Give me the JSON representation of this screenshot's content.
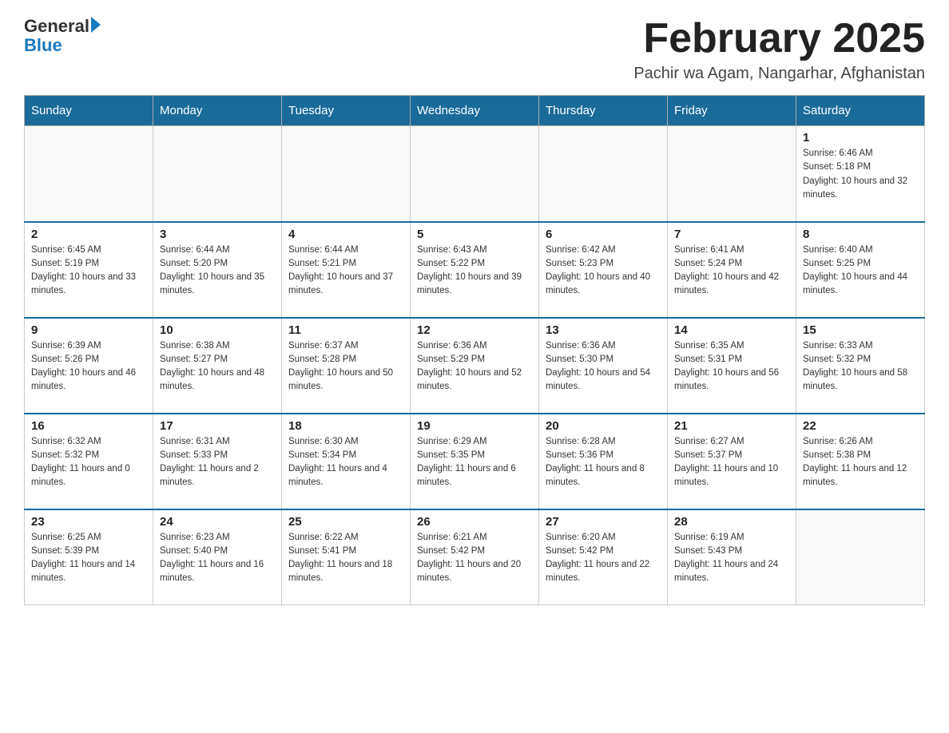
{
  "logo": {
    "general": "General",
    "blue": "Blue"
  },
  "header": {
    "title": "February 2025",
    "subtitle": "Pachir wa Agam, Nangarhar, Afghanistan"
  },
  "days_of_week": [
    "Sunday",
    "Monday",
    "Tuesday",
    "Wednesday",
    "Thursday",
    "Friday",
    "Saturday"
  ],
  "weeks": [
    [
      {
        "day": "",
        "info": ""
      },
      {
        "day": "",
        "info": ""
      },
      {
        "day": "",
        "info": ""
      },
      {
        "day": "",
        "info": ""
      },
      {
        "day": "",
        "info": ""
      },
      {
        "day": "",
        "info": ""
      },
      {
        "day": "1",
        "info": "Sunrise: 6:46 AM\nSunset: 5:18 PM\nDaylight: 10 hours and 32 minutes."
      }
    ],
    [
      {
        "day": "2",
        "info": "Sunrise: 6:45 AM\nSunset: 5:19 PM\nDaylight: 10 hours and 33 minutes."
      },
      {
        "day": "3",
        "info": "Sunrise: 6:44 AM\nSunset: 5:20 PM\nDaylight: 10 hours and 35 minutes."
      },
      {
        "day": "4",
        "info": "Sunrise: 6:44 AM\nSunset: 5:21 PM\nDaylight: 10 hours and 37 minutes."
      },
      {
        "day": "5",
        "info": "Sunrise: 6:43 AM\nSunset: 5:22 PM\nDaylight: 10 hours and 39 minutes."
      },
      {
        "day": "6",
        "info": "Sunrise: 6:42 AM\nSunset: 5:23 PM\nDaylight: 10 hours and 40 minutes."
      },
      {
        "day": "7",
        "info": "Sunrise: 6:41 AM\nSunset: 5:24 PM\nDaylight: 10 hours and 42 minutes."
      },
      {
        "day": "8",
        "info": "Sunrise: 6:40 AM\nSunset: 5:25 PM\nDaylight: 10 hours and 44 minutes."
      }
    ],
    [
      {
        "day": "9",
        "info": "Sunrise: 6:39 AM\nSunset: 5:26 PM\nDaylight: 10 hours and 46 minutes."
      },
      {
        "day": "10",
        "info": "Sunrise: 6:38 AM\nSunset: 5:27 PM\nDaylight: 10 hours and 48 minutes."
      },
      {
        "day": "11",
        "info": "Sunrise: 6:37 AM\nSunset: 5:28 PM\nDaylight: 10 hours and 50 minutes."
      },
      {
        "day": "12",
        "info": "Sunrise: 6:36 AM\nSunset: 5:29 PM\nDaylight: 10 hours and 52 minutes."
      },
      {
        "day": "13",
        "info": "Sunrise: 6:36 AM\nSunset: 5:30 PM\nDaylight: 10 hours and 54 minutes."
      },
      {
        "day": "14",
        "info": "Sunrise: 6:35 AM\nSunset: 5:31 PM\nDaylight: 10 hours and 56 minutes."
      },
      {
        "day": "15",
        "info": "Sunrise: 6:33 AM\nSunset: 5:32 PM\nDaylight: 10 hours and 58 minutes."
      }
    ],
    [
      {
        "day": "16",
        "info": "Sunrise: 6:32 AM\nSunset: 5:32 PM\nDaylight: 11 hours and 0 minutes."
      },
      {
        "day": "17",
        "info": "Sunrise: 6:31 AM\nSunset: 5:33 PM\nDaylight: 11 hours and 2 minutes."
      },
      {
        "day": "18",
        "info": "Sunrise: 6:30 AM\nSunset: 5:34 PM\nDaylight: 11 hours and 4 minutes."
      },
      {
        "day": "19",
        "info": "Sunrise: 6:29 AM\nSunset: 5:35 PM\nDaylight: 11 hours and 6 minutes."
      },
      {
        "day": "20",
        "info": "Sunrise: 6:28 AM\nSunset: 5:36 PM\nDaylight: 11 hours and 8 minutes."
      },
      {
        "day": "21",
        "info": "Sunrise: 6:27 AM\nSunset: 5:37 PM\nDaylight: 11 hours and 10 minutes."
      },
      {
        "day": "22",
        "info": "Sunrise: 6:26 AM\nSunset: 5:38 PM\nDaylight: 11 hours and 12 minutes."
      }
    ],
    [
      {
        "day": "23",
        "info": "Sunrise: 6:25 AM\nSunset: 5:39 PM\nDaylight: 11 hours and 14 minutes."
      },
      {
        "day": "24",
        "info": "Sunrise: 6:23 AM\nSunset: 5:40 PM\nDaylight: 11 hours and 16 minutes."
      },
      {
        "day": "25",
        "info": "Sunrise: 6:22 AM\nSunset: 5:41 PM\nDaylight: 11 hours and 18 minutes."
      },
      {
        "day": "26",
        "info": "Sunrise: 6:21 AM\nSunset: 5:42 PM\nDaylight: 11 hours and 20 minutes."
      },
      {
        "day": "27",
        "info": "Sunrise: 6:20 AM\nSunset: 5:42 PM\nDaylight: 11 hours and 22 minutes."
      },
      {
        "day": "28",
        "info": "Sunrise: 6:19 AM\nSunset: 5:43 PM\nDaylight: 11 hours and 24 minutes."
      },
      {
        "day": "",
        "info": ""
      }
    ]
  ]
}
